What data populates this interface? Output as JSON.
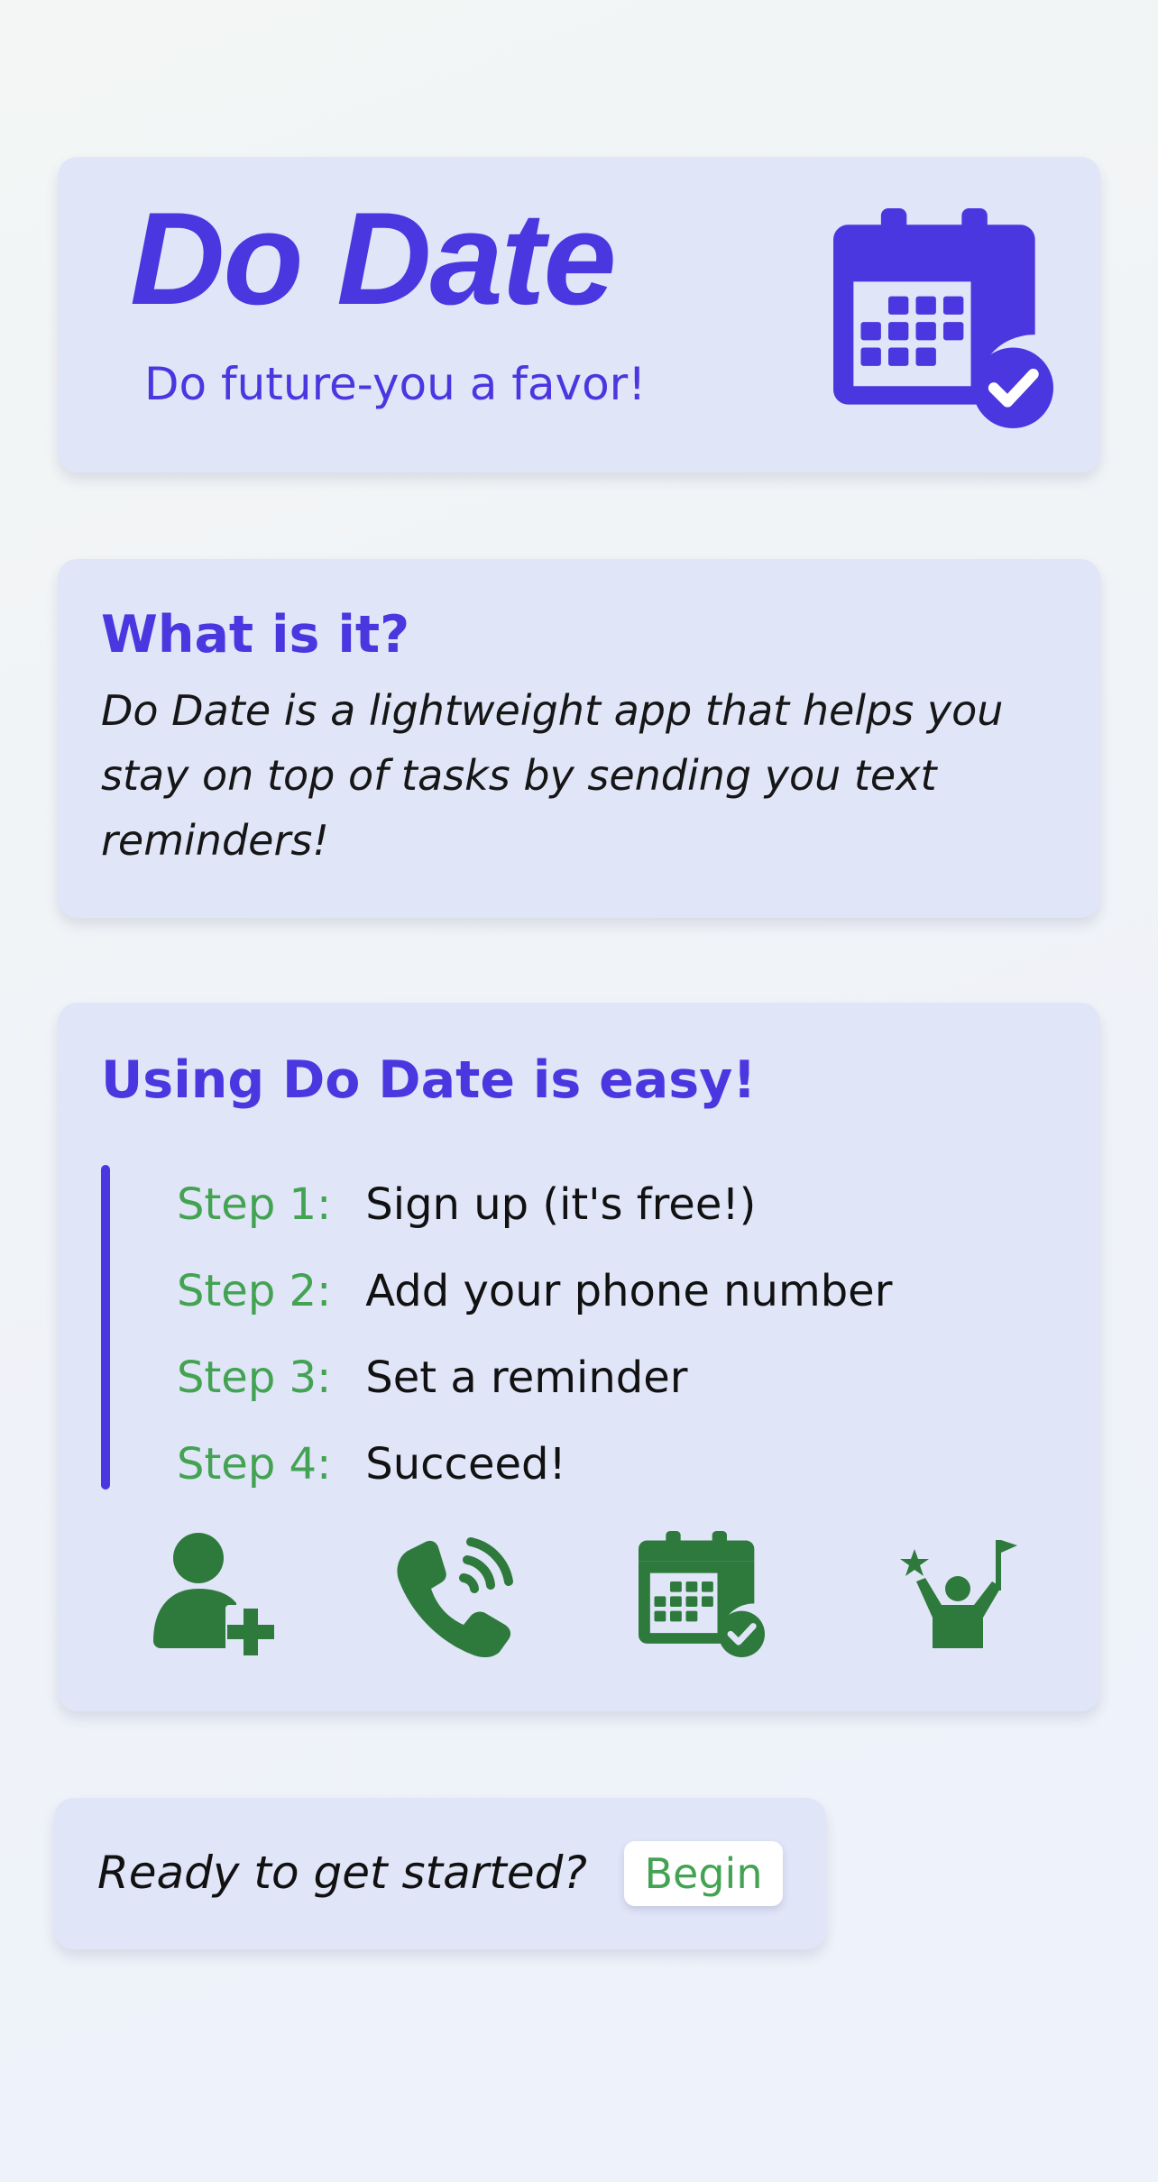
{
  "colors": {
    "accent": "#4b37e0",
    "step_label": "#43a352",
    "icon_green": "#2e7a3c",
    "card_bg": "#e0e5f8"
  },
  "hero": {
    "title": "Do Date",
    "tagline": "Do future-you a favor!",
    "icon": "calendar-check-icon"
  },
  "about": {
    "heading": "What is it?",
    "body": "Do Date is a lightweight app that helps you stay on top of tasks by sending you text reminders!"
  },
  "steps": {
    "heading": "Using Do Date is easy!",
    "items": [
      {
        "label": "Step 1:",
        "text": "Sign up (it's free!)",
        "icon": "user-plus-icon"
      },
      {
        "label": "Step 2:",
        "text": "Add your phone number",
        "icon": "phone-volume-icon"
      },
      {
        "label": "Step 3:",
        "text": "Set a reminder",
        "icon": "calendar-check-icon"
      },
      {
        "label": "Step 4:",
        "text": "Succeed!",
        "icon": "person-celebrating-icon"
      }
    ]
  },
  "cta": {
    "prompt": "Ready to get started?",
    "button_label": "Begin"
  }
}
